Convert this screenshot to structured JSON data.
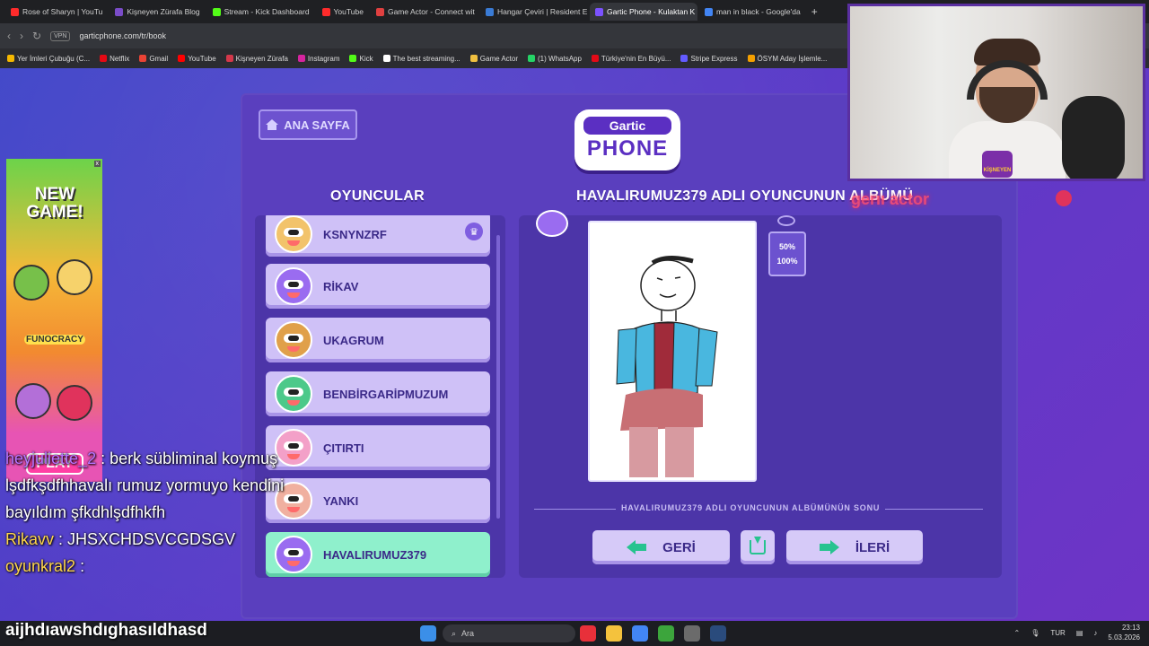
{
  "browser": {
    "tabs": [
      {
        "label": "Rose of Sharyn | YouTu",
        "color": "#ff2b2b",
        "active": false
      },
      {
        "label": "Kişneyen Zürafa Blog",
        "color": "#7a4cc8",
        "active": false
      },
      {
        "label": "Stream - Kick Dashboard",
        "color": "#53fc18",
        "active": false
      },
      {
        "label": "YouTube",
        "color": "#ff2b2b",
        "active": false
      },
      {
        "label": "Game Actor - Connect wit",
        "color": "#e04040",
        "active": false
      },
      {
        "label": "Hangar Çeviri | Resident E",
        "color": "#3a7bd5",
        "active": false
      },
      {
        "label": "Gartic Phone - Kulaktan K",
        "color": "#7b52ff",
        "active": true
      },
      {
        "label": "man in black - Google'da",
        "color": "#4285f4",
        "active": false
      }
    ],
    "vpn_label": "VPN",
    "url": "garticphone.com/tr/book",
    "bookmarks": [
      {
        "label": "Yer İmleri Çubuğu (C...",
        "color": "#f5b800"
      },
      {
        "label": "Netflix",
        "color": "#e50914"
      },
      {
        "label": "Gmail",
        "color": "#ea4335"
      },
      {
        "label": "YouTube",
        "color": "#ff0000"
      },
      {
        "label": "Kişneyen Zürafa",
        "color": "#d4384a"
      },
      {
        "label": "Instagram",
        "color": "#d6249f"
      },
      {
        "label": "Kick",
        "color": "#53fc18"
      },
      {
        "label": "The best streaming...",
        "color": "#ffffff"
      },
      {
        "label": "Game Actor",
        "color": "#f0c040"
      },
      {
        "label": "(1) WhatsApp",
        "color": "#25d366"
      },
      {
        "label": "Türkiye'nin En Büyü...",
        "color": "#e30a17"
      },
      {
        "label": "Stripe Express",
        "color": "#635bff"
      },
      {
        "label": "ÖSYM Aday İşlemle...",
        "color": "#f5a000"
      }
    ]
  },
  "game": {
    "home_button": "ANA SAYFA",
    "logo_top": "Gartic",
    "logo_main": "PHONE",
    "players_title": "OYUNCULAR",
    "album_title": "HAVALIRUMUZ379 ADLI OYUNCUNUN ALBÜMÜ",
    "players": [
      {
        "name": "KSNYNZRF",
        "color": "#f2c36b",
        "host": true,
        "selected": false
      },
      {
        "name": "RİKAV",
        "color": "#9a6cf0",
        "host": false,
        "selected": false
      },
      {
        "name": "UKAGRUM",
        "color": "#e0a04a",
        "host": false,
        "selected": false
      },
      {
        "name": "BENBİRGARİPMUZUM",
        "color": "#4cc98a",
        "host": false,
        "selected": false
      },
      {
        "name": "ÇITIRTI",
        "color": "#f3a0c8",
        "host": false,
        "selected": false
      },
      {
        "name": "YANKI",
        "color": "#f0b0a0",
        "host": false,
        "selected": false
      },
      {
        "name": "HAVALIRUMUZ379",
        "color": "#9a6cf0",
        "host": false,
        "selected": true
      }
    ],
    "zoom_options": [
      "50%",
      "100%"
    ],
    "album_end": "HAVALIRUMUZ379 ADLI OYUNCUNUN ALBÜMÜNÜN SONU",
    "back_button": "GERİ",
    "next_button": "İLERİ"
  },
  "ad": {
    "title": "NEW GAME!",
    "brand": "FUNOCRACY",
    "play": "PLAY"
  },
  "chat": [
    {
      "user": "heyjuliette_2",
      "text": ": berk sübliminal koymuş lşdfkşdfhhavalı rumuz yormuyo kendini bayıldım şfkdhlşdfhkfh"
    },
    {
      "user": "Rikavv",
      "text": ": JHSXCHDSVCGDSGV"
    },
    {
      "user": "oyunkral2",
      "text": ":"
    }
  ],
  "chat_input": "aijhdıawshdıghasıldhasd",
  "overlay_text": "gerıı actor",
  "cam_badge": "KİŞNEYEN",
  "taskbar": {
    "search_placeholder": "Ara",
    "lang": "TUR",
    "time": "23:13",
    "date": "5.03.2026"
  }
}
